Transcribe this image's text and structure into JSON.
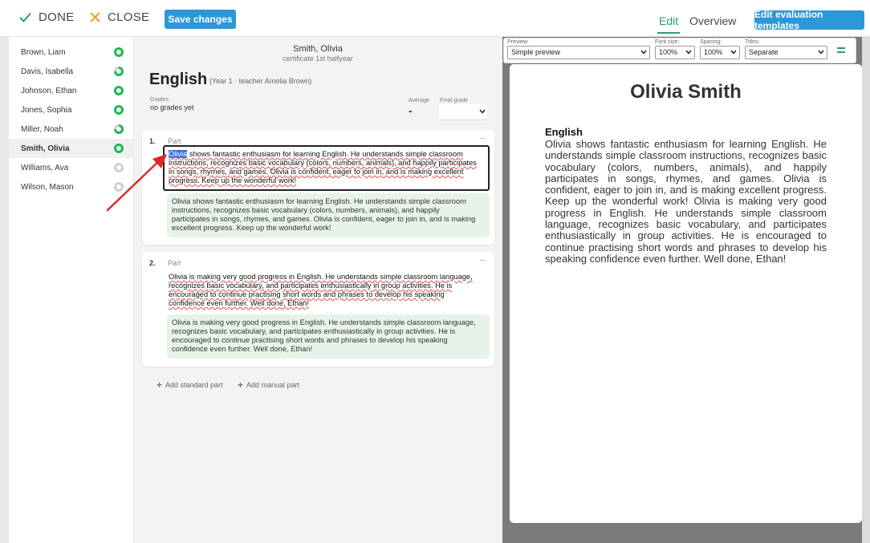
{
  "topbar": {
    "done_label": "DONE",
    "close_label": "CLOSE",
    "save_label": "Save changes",
    "tab_edit": "Edit",
    "tab_overview": "Overview",
    "templates_label": "Edit evaluation templates"
  },
  "sidebar": {
    "students": [
      {
        "name": "Brown, Liam",
        "status": "complete"
      },
      {
        "name": "Davis, Isabella",
        "status": "partial"
      },
      {
        "name": "Johnson, Ethan",
        "status": "complete"
      },
      {
        "name": "Jones, Sophia",
        "status": "complete"
      },
      {
        "name": "Miller, Noah",
        "status": "partial"
      },
      {
        "name": "Smith, Olivia",
        "status": "complete",
        "selected": true
      },
      {
        "name": "Williams, Ava",
        "status": "empty"
      },
      {
        "name": "Wilson, Mason",
        "status": "empty"
      }
    ]
  },
  "header": {
    "student": "Smith, Olivia",
    "certificate": "certificate 1st halfyear"
  },
  "subject": {
    "title": "English",
    "meta": "(Year 1 · teacher Amelia Brown)",
    "grades_label": "Grades",
    "grades_value": "no grades yet",
    "average_label": "Average",
    "average_value": "-",
    "final_label": "Final grade",
    "final_value": ""
  },
  "parts": [
    {
      "number": "1.",
      "label": "Part",
      "menu": "···",
      "text_lines": [
        "shows fantastic enthusiasm for learning English. He understands simple classroom",
        "instructions, recognizes basic vocabulary (colors, numbers, animals), and happily participates",
        "in songs, rhymes, and games. Olivia is confident, eager to join in, and is making excellent",
        "progress. Keep up the wonderful work!"
      ],
      "selected_word": "Olivia",
      "suggestion_lines": [
        "Olivia shows fantastic enthusiasm for learning English. He understands simple classroom",
        "instructions, recognizes basic vocabulary (colors, numbers, animals), and happily",
        "participates in songs, rhymes, and games. Olivia is confident, eager to join in, and is making",
        "excellent progress. Keep up the wonderful work!"
      ]
    },
    {
      "number": "2.",
      "label": "Part",
      "menu": "···",
      "text_lines": [
        "Olivia is making very good progress in English. He understands simple classroom language,",
        "recognizes basic vocabulary, and participates enthusiastically in group activities. He is",
        "encouraged to continue practising short words and phrases to develop his speaking",
        "confidence even further. Well done, Ethan!"
      ],
      "suggestion_lines": [
        "Olivia is making very good progress in English. He understands simple classroom language,",
        "recognizes basic vocabulary, and participates enthusiastically in group activities. He is",
        "encouraged to continue practising short words and phrases to develop his speaking",
        "confidence even further. Well done, Ethan!"
      ]
    }
  ],
  "add": {
    "standard": "Add standard part",
    "manual": "Add manual part"
  },
  "preview_toolbar": {
    "preview_label": "Preview:",
    "preview_value": "Simple preview",
    "fontsize_label": "Font size:",
    "fontsize_value": "100%",
    "spacing_label": "Spacing:",
    "spacing_value": "100%",
    "titles_label": "Titles:",
    "titles_value": "Separate",
    "menu_icon": "hamburger-icon"
  },
  "preview_page": {
    "name": "Olivia Smith",
    "subject": "English",
    "text": "Olivia shows fantastic enthusiasm for learning English. He understands simple classroom instructions, recognizes basic vocabulary (colors, numbers, animals), and happily participates in songs, rhymes, and games. Olivia is confident, eager to join in, and is making excellent progress. Keep up the wonderful work! Olivia is making very good progress in English. He understands simple classroom language, recognizes basic vocabulary, and participates enthusiastically in group activities. He is encouraged to continue practising short words and phrases to develop his speaking confidence even further. Well done, Ethan!"
  },
  "colors": {
    "accent_blue": "#2c97d9",
    "accent_green": "#2aa06a",
    "status_green": "#1fb84f",
    "done_check": "#2aa06a",
    "close_x": "#f0a020",
    "suggestion_bg": "#e7f3e8",
    "arrow_red": "#e02828"
  }
}
